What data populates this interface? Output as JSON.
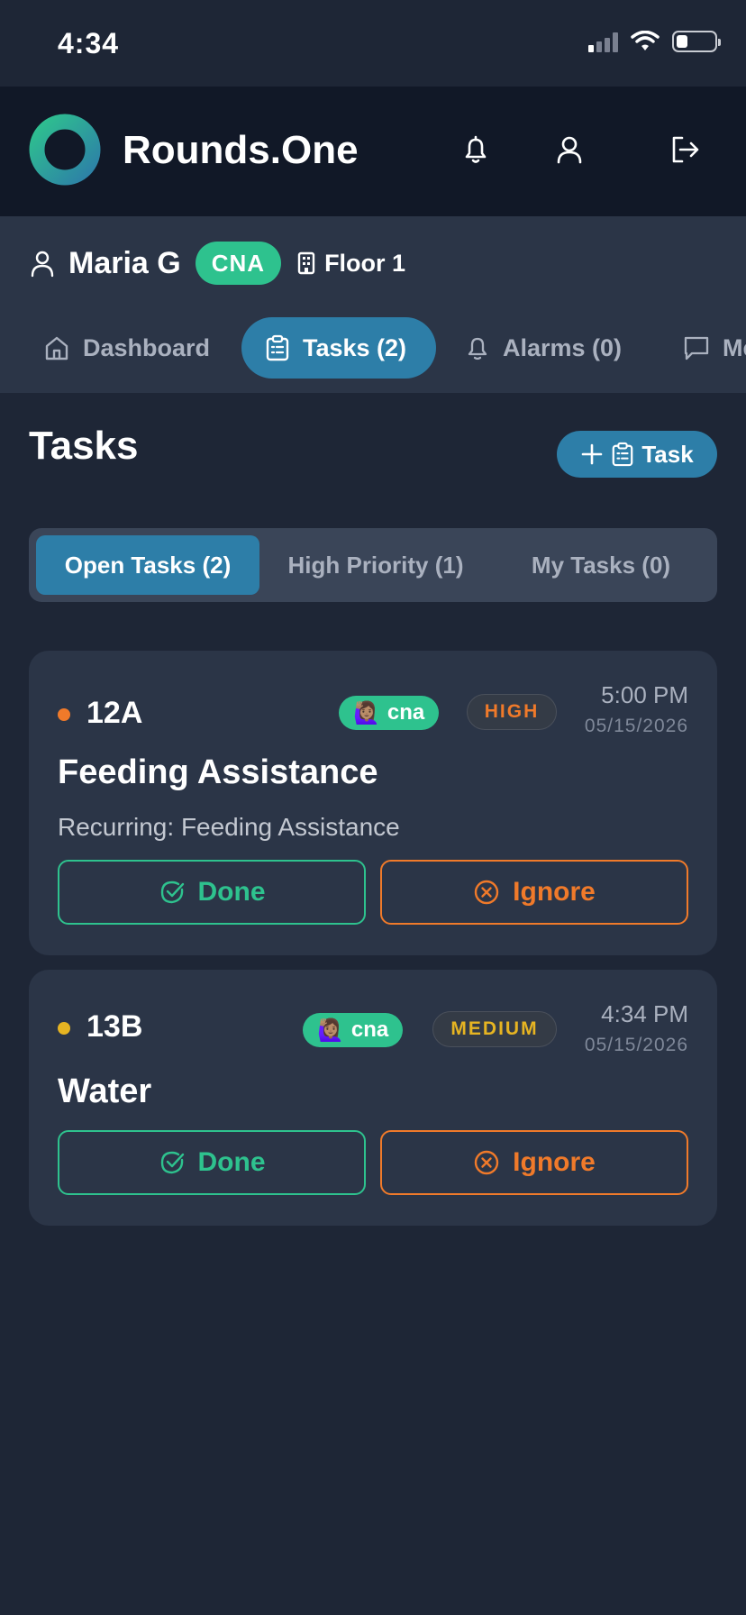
{
  "status_bar": {
    "time": "4:34"
  },
  "app": {
    "title": "Rounds.One",
    "icons": [
      "bell-icon",
      "user-icon",
      "logout-icon"
    ]
  },
  "user": {
    "name": "Maria G",
    "role": "CNA",
    "floor": "Floor 1"
  },
  "nav": {
    "tabs": [
      {
        "label": "Dashboard",
        "icon": "home-icon"
      },
      {
        "label": "Tasks (2)",
        "icon": "clipboard-icon",
        "active": true
      },
      {
        "label": "Alarms (0)",
        "icon": "bell-icon"
      },
      {
        "label": "Me",
        "icon": "message-icon"
      }
    ]
  },
  "page": {
    "title": "Tasks",
    "add_task_label": "Task"
  },
  "filters": {
    "tabs": [
      {
        "label": "Open Tasks (2)",
        "active": true
      },
      {
        "label": "High Priority (1)"
      },
      {
        "label": "My Tasks (0)"
      }
    ]
  },
  "tasks": [
    {
      "room": "12A",
      "dot_color": "#f07a2a",
      "assignee": "cna",
      "assignee_emoji": "🙋🏽‍♀️",
      "priority": "HIGH",
      "priority_color": "#f07a2a",
      "time": "5:00 PM",
      "date": "05/15/2026",
      "title": "Feeding Assistance",
      "subtitle": "Recurring: Feeding Assistance",
      "done_label": "Done",
      "ignore_label": "Ignore"
    },
    {
      "room": "13B",
      "dot_color": "#e6b422",
      "assignee": "cna",
      "assignee_emoji": "🙋🏽‍♀️",
      "priority": "MEDIUM",
      "priority_color": "#e6b422",
      "time": "4:34 PM",
      "date": "05/15/2026",
      "title": "Water",
      "done_label": "Done",
      "ignore_label": "Ignore"
    }
  ],
  "colors": {
    "accent": "#2d7ea8",
    "success": "#2ec28e",
    "warning": "#f07a2a",
    "medium": "#e6b422"
  }
}
